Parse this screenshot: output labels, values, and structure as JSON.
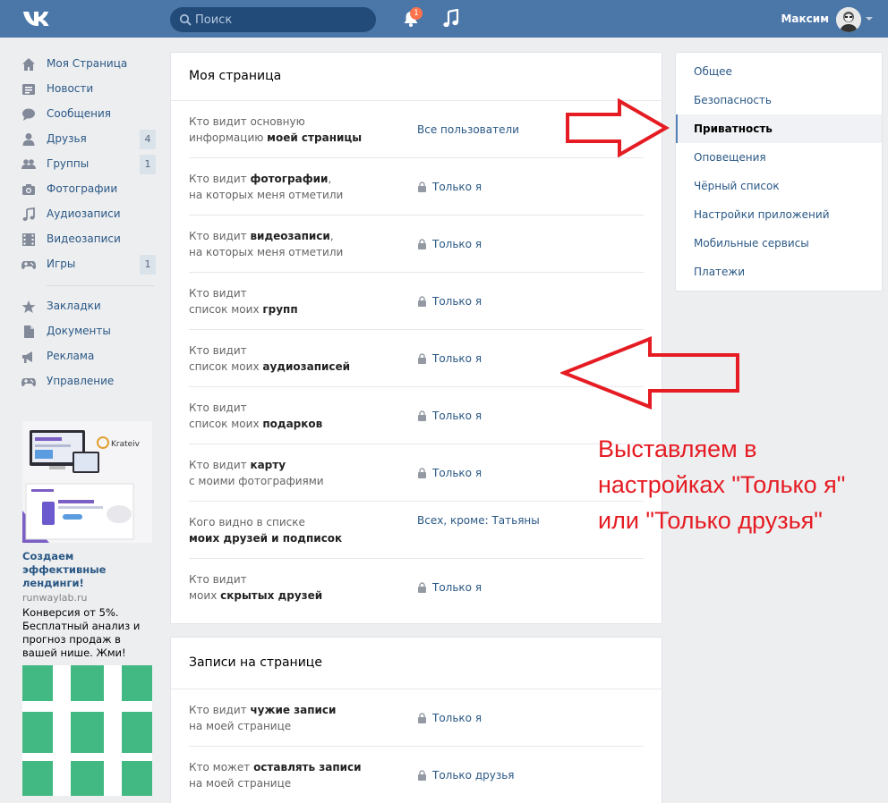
{
  "topbar": {
    "search_placeholder": "Поиск",
    "notifications_count": "1",
    "username": "Максим"
  },
  "nav": {
    "items": [
      {
        "label": "Моя Страница",
        "icon": "home-icon"
      },
      {
        "label": "Новости",
        "icon": "news-icon"
      },
      {
        "label": "Сообщения",
        "icon": "messages-icon"
      },
      {
        "label": "Друзья",
        "icon": "friends-icon",
        "count": "4"
      },
      {
        "label": "Группы",
        "icon": "groups-icon",
        "count": "1"
      },
      {
        "label": "Фотографии",
        "icon": "camera-icon"
      },
      {
        "label": "Аудиозаписи",
        "icon": "music-note-icon"
      },
      {
        "label": "Видеозаписи",
        "icon": "film-icon"
      },
      {
        "label": "Игры",
        "icon": "gamepad-icon",
        "count": "1"
      }
    ],
    "secondary": [
      {
        "label": "Закладки",
        "icon": "star-icon"
      },
      {
        "label": "Документы",
        "icon": "document-icon"
      },
      {
        "label": "Реклама",
        "icon": "megaphone-icon"
      },
      {
        "label": "Управление",
        "icon": "gamepad-icon"
      }
    ]
  },
  "ad": {
    "brand": "Krateiv",
    "title": "Создаем эффективные лендинги!",
    "domain": "runwaylab.ru",
    "text": "Конверсия от 5%. Бесплатный анализ и прогноз продаж в вашей нише. Жми!"
  },
  "panel1": {
    "title": "Моя страница",
    "rows": [
      {
        "q1": "Кто видит основную",
        "q2a": "информацию ",
        "q2b": "моей страницы",
        "answer": "Все пользователи",
        "locked": false
      },
      {
        "q1a": "Кто видит ",
        "q1b": "фотографии",
        "q1c": ",",
        "q2": "на которых меня отметили",
        "answer": "Только я",
        "locked": true
      },
      {
        "q1a": "Кто видит ",
        "q1b": "видеозаписи",
        "q1c": ",",
        "q2": "на которых меня отметили",
        "answer": "Только я",
        "locked": true
      },
      {
        "q1": "Кто видит",
        "q2a": "список моих ",
        "q2b": "групп",
        "answer": "Только я",
        "locked": true
      },
      {
        "q1": "Кто видит",
        "q2a": "список моих ",
        "q2b": "аудиозаписей",
        "answer": "Только я",
        "locked": true
      },
      {
        "q1": "Кто видит",
        "q2a": "список моих ",
        "q2b": "подарков",
        "answer": "Только я",
        "locked": true
      },
      {
        "q1a": "Кто видит ",
        "q1b": "карту",
        "q1c": "",
        "q2": "с моими фотографиями",
        "answer": "Только я",
        "locked": true
      },
      {
        "q1": "Кого видно в списке",
        "q2a": "",
        "q2b": "моих друзей и подписок",
        "answer": "Всех, кроме: Татьяны",
        "locked": false
      },
      {
        "q1": "Кто видит",
        "q2a": "моих ",
        "q2b": "скрытых друзей",
        "answer": "Только я",
        "locked": true
      }
    ]
  },
  "panel2": {
    "title": "Записи на странице",
    "rows": [
      {
        "q1a": "Кто видит ",
        "q1b": "чужие записи",
        "q2": "на моей странице",
        "answer": "Только я"
      },
      {
        "q1a": "Кто может ",
        "q1b": "оставлять записи",
        "q2": "на моей странице",
        "answer": "Только друзья"
      }
    ]
  },
  "settings_menu": {
    "items": [
      "Общее",
      "Безопасность",
      "Приватность",
      "Оповещения",
      "Чёрный список",
      "Настройки приложений",
      "Мобильные сервисы",
      "Платежи"
    ],
    "active_index": 2
  },
  "annotation": {
    "line1": "Выставляем в",
    "line2": "настройках \"Только я\"",
    "line3": "или \"Только друзья\"",
    "color": "#e51c23"
  },
  "colors": {
    "topbar": "#4a76a8",
    "link": "#2a5885",
    "background": "#edeef0"
  }
}
